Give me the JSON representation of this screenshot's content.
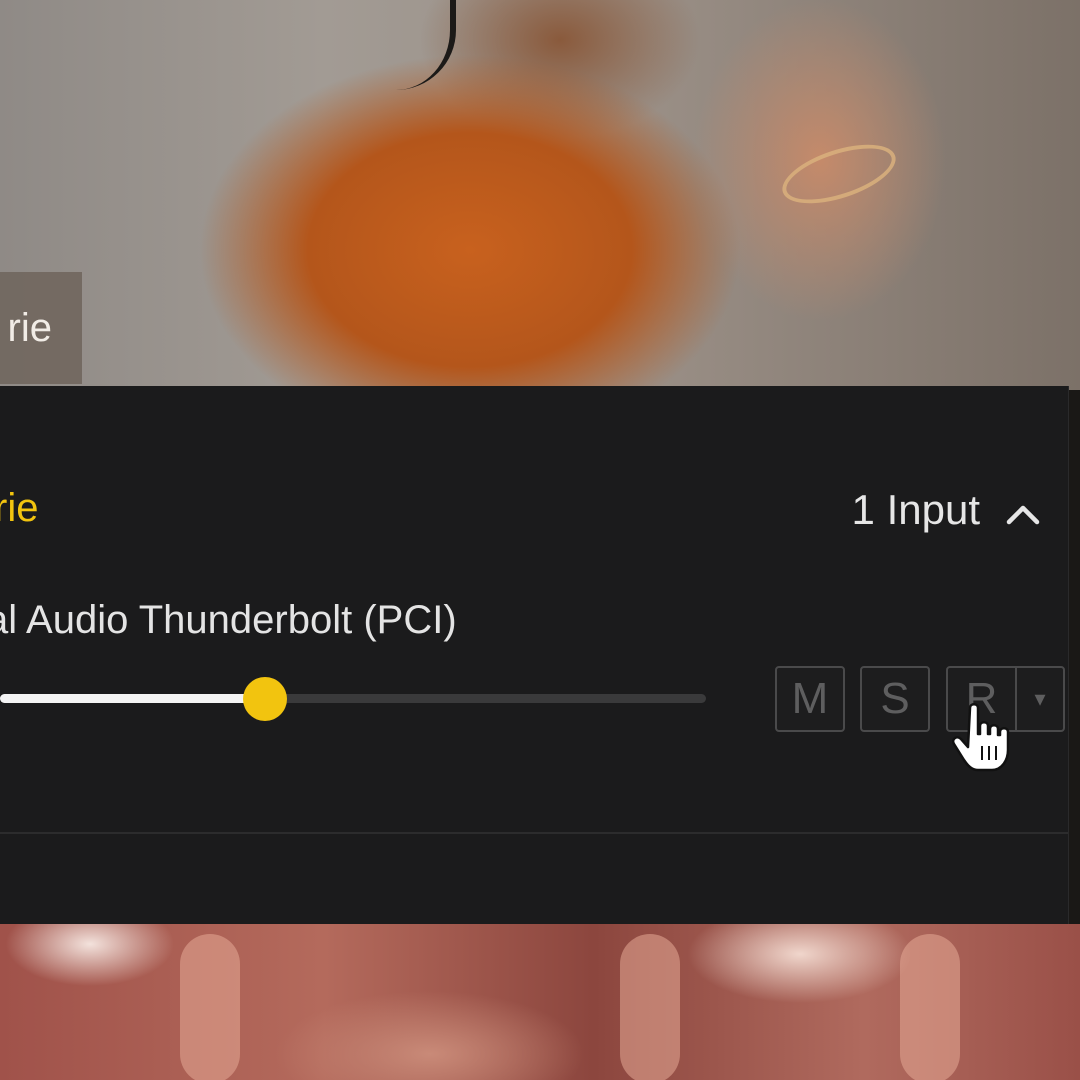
{
  "video_tile": {
    "participant_label": "rie"
  },
  "track": {
    "name": "rie",
    "input_count_label": "1 Input",
    "device_name": "al Audio Thunderbolt (PCI)",
    "volume_fraction": 0.375
  },
  "controls": {
    "mute_label": "M",
    "solo_label": "S",
    "record_label": "R",
    "dropdown_label": "▾"
  },
  "colors": {
    "accent": "#f2c40f",
    "panel_bg": "#1b1b1c"
  },
  "icons": {
    "collapse": "chevron-up-icon",
    "cursor": "hand-pointer-icon"
  }
}
